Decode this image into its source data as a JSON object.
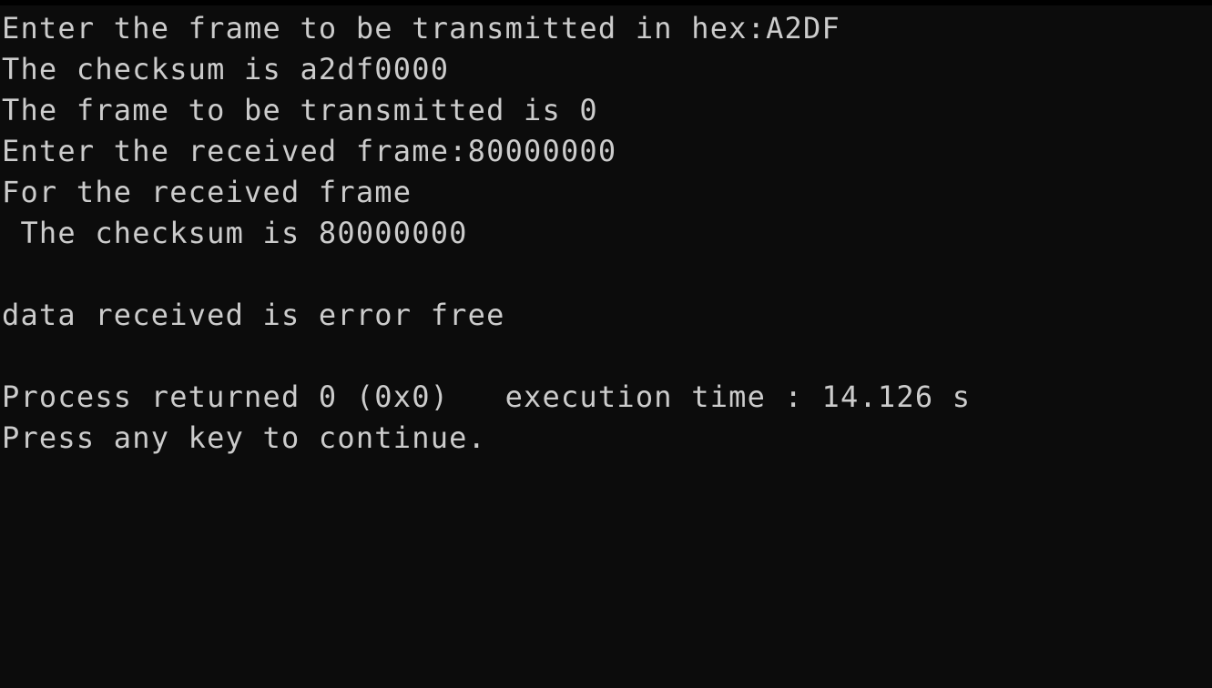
{
  "colors": {
    "background": "#0c0c0c",
    "text": "#cccccc"
  },
  "console": {
    "lines": [
      "Enter the frame to be transmitted in hex:A2DF",
      "The checksum is a2df0000",
      "The frame to be transmitted is 0",
      "Enter the received frame:80000000",
      "For the received frame",
      " The checksum is 80000000",
      "",
      "data received is error free",
      "",
      "Process returned 0 (0x0)   execution time : 14.126 s",
      "Press any key to continue."
    ]
  }
}
